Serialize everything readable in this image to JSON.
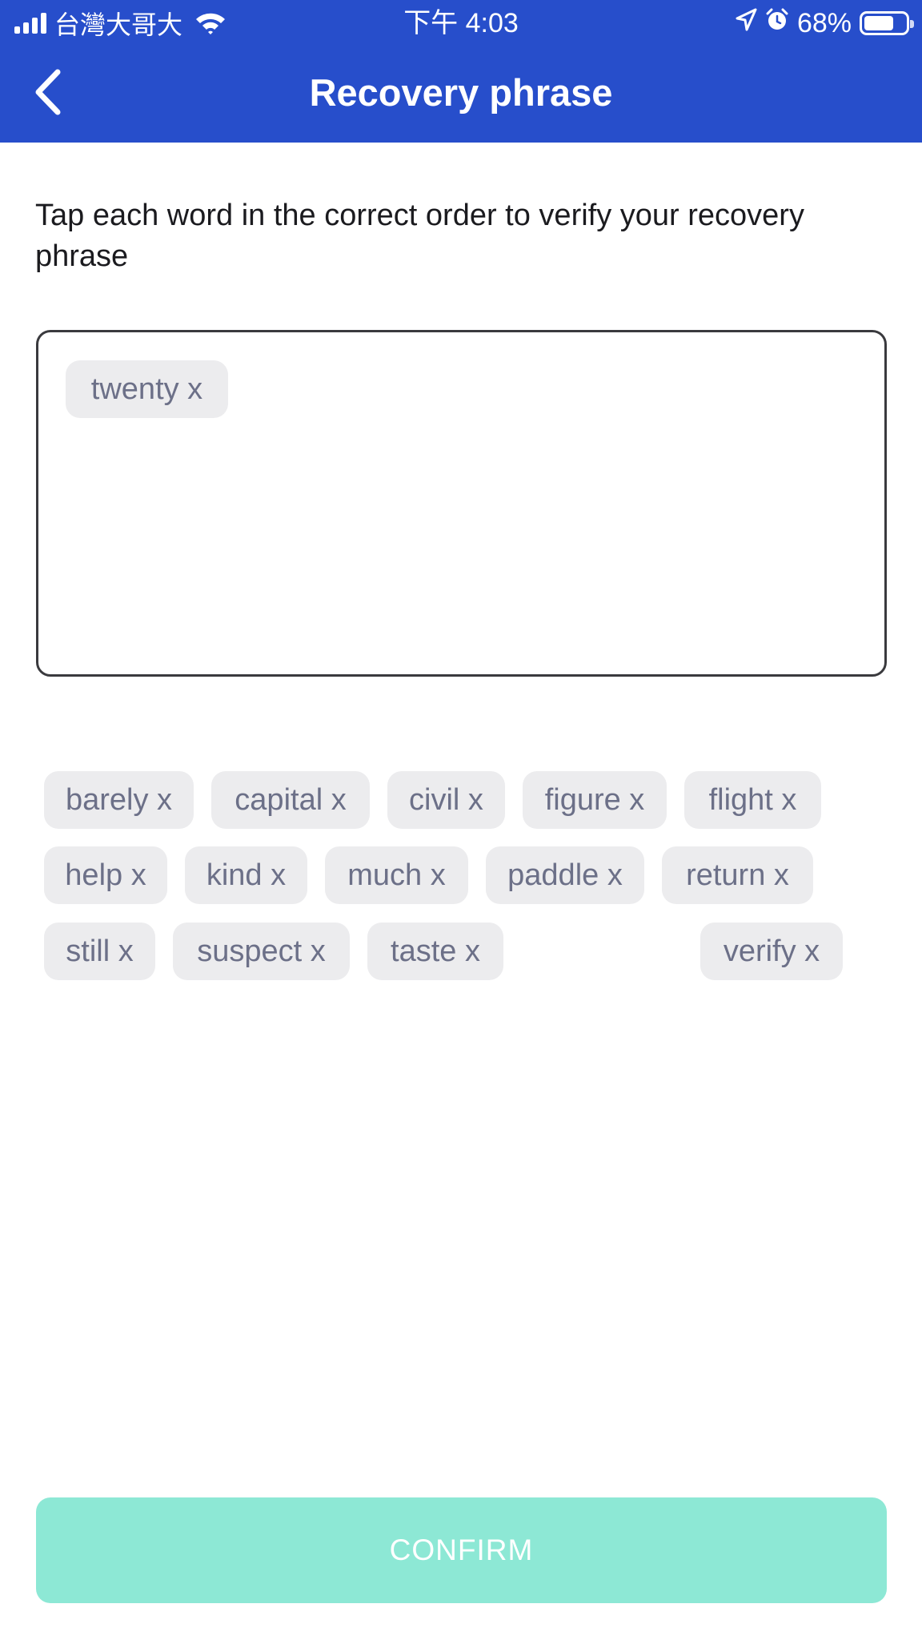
{
  "status_bar": {
    "carrier": "台灣大哥大",
    "time": "下午 4:03",
    "battery": "68%",
    "battery_level": 0.68,
    "icons": [
      "signal-icon",
      "wifi-icon",
      "location-arrow-icon",
      "alarm-icon",
      "battery-icon"
    ]
  },
  "header": {
    "title": "Recovery phrase",
    "back_icon": "chevron-left-icon",
    "background": "#274ecb"
  },
  "instructions": "Tap each word in the correct order to verify your recovery phrase",
  "selected_words": [
    "twenty x"
  ],
  "word_bank": [
    "barely x",
    "capital x",
    "civil x",
    "figure x",
    "flight x",
    "help x",
    "kind x",
    "much x",
    "paddle x",
    "return x",
    "still x",
    "suspect x",
    "taste x",
    "verify x"
  ],
  "confirm": {
    "label": "CONFIRM",
    "color": "#8de8d5"
  }
}
